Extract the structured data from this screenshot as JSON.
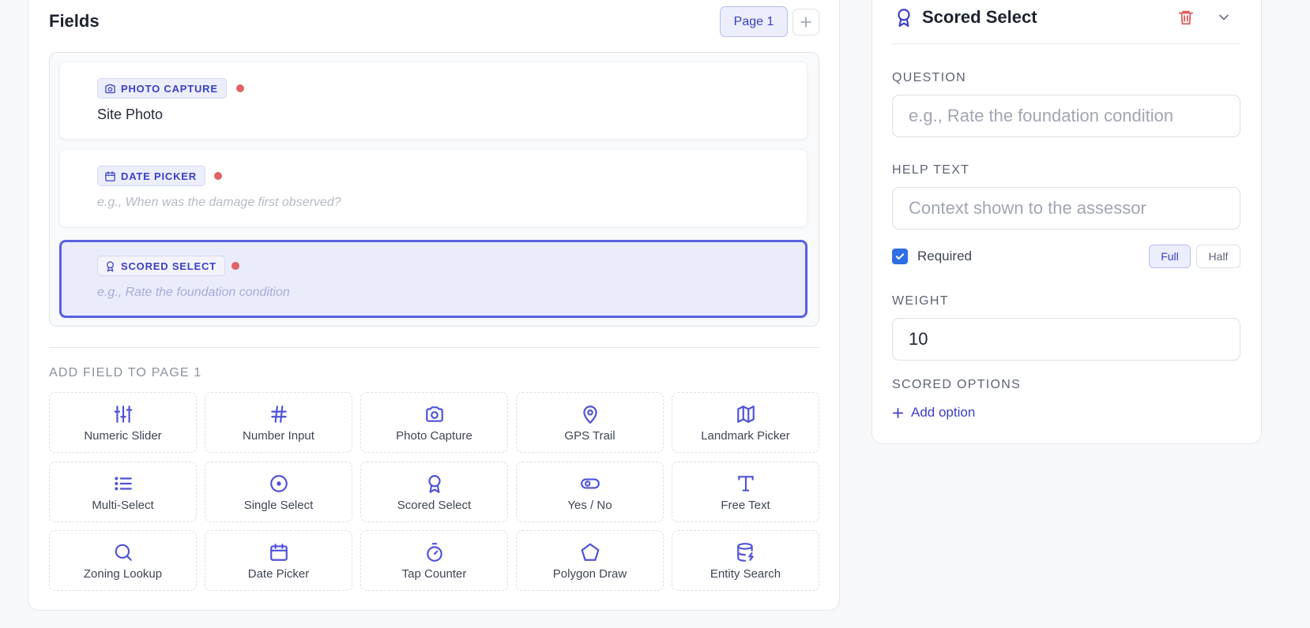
{
  "fields_panel": {
    "title": "Fields",
    "page_pill": "Page 1",
    "add_page_symbol": "+"
  },
  "fields": [
    {
      "type_label": "PHOTO CAPTURE",
      "icon": "camera-icon",
      "label": "Site Photo",
      "placeholder": "",
      "required": true,
      "selected": false
    },
    {
      "type_label": "DATE PICKER",
      "icon": "calendar-icon",
      "label": "",
      "placeholder": "e.g., When was the damage first observed?",
      "required": true,
      "selected": false
    },
    {
      "type_label": "SCORED SELECT",
      "icon": "award-icon",
      "label": "",
      "placeholder": "e.g., Rate the foundation condition",
      "required": true,
      "selected": true
    }
  ],
  "add_field_heading": "ADD FIELD TO PAGE 1",
  "palette": [
    {
      "label": "Numeric Slider",
      "icon": "sliders-icon"
    },
    {
      "label": "Number Input",
      "icon": "hash-icon"
    },
    {
      "label": "Photo Capture",
      "icon": "camera-icon"
    },
    {
      "label": "GPS Trail",
      "icon": "map-pin-icon"
    },
    {
      "label": "Landmark Picker",
      "icon": "map-icon"
    },
    {
      "label": "Multi-Select",
      "icon": "list-icon"
    },
    {
      "label": "Single Select",
      "icon": "radio-circle-icon"
    },
    {
      "label": "Scored Select",
      "icon": "award-icon"
    },
    {
      "label": "Yes / No",
      "icon": "toggle-icon"
    },
    {
      "label": "Free Text",
      "icon": "type-icon"
    },
    {
      "label": "Zoning Lookup",
      "icon": "search-icon"
    },
    {
      "label": "Date Picker",
      "icon": "calendar-icon"
    },
    {
      "label": "Tap Counter",
      "icon": "timer-icon"
    },
    {
      "label": "Polygon Draw",
      "icon": "pentagon-icon"
    },
    {
      "label": "Entity Search",
      "icon": "database-icon"
    }
  ],
  "properties": {
    "title": "Scored Select",
    "question_label": "QUESTION",
    "question_placeholder": "e.g., Rate the foundation condition",
    "help_label": "HELP TEXT",
    "help_placeholder": "Context shown to the assessor",
    "required_label": "Required",
    "required_checked": true,
    "width_full": "Full",
    "width_half": "Half",
    "width_selected": "Full",
    "weight_label": "WEIGHT",
    "weight_value": "10",
    "scored_options_label": "SCORED OPTIONS",
    "add_option_label": "Add option"
  },
  "colors": {
    "accent": "#3b3fc4",
    "selected_border": "#5b5fe0",
    "required_dot": "#e06464",
    "delete": "#e05a5a",
    "checkbox": "#2f6fe6"
  }
}
